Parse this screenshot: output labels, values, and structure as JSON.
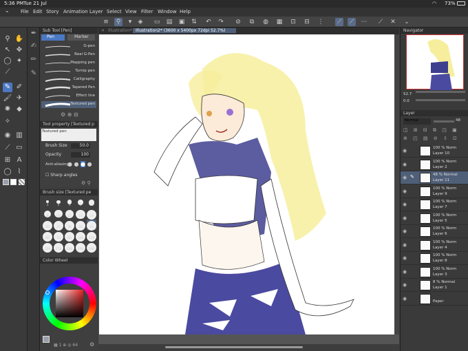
{
  "status": {
    "time": "5:36 PM",
    "date": "Tue 21 Jul",
    "battery": "73%"
  },
  "menu": [
    "File",
    "Edit",
    "Story",
    "Animation",
    "Layer",
    "Select",
    "View",
    "Filter",
    "Window",
    "Help"
  ],
  "subtool": {
    "header": "Sub Tool [Pen]",
    "tabs": [
      "Pen",
      "Marker"
    ],
    "brushes": [
      "G-pen",
      "Real G-Pen",
      "Mapping pen",
      "Turnip pen",
      "Calligraphy",
      "Tapered Pen",
      "Effect line",
      "Textured pen"
    ]
  },
  "toolprop": {
    "header": "Tool property [Textured p",
    "brush_name": "Textured pen",
    "brush_size_label": "Brush Size",
    "brush_size_value": "50.0",
    "opacity_label": "Opacity",
    "opacity_value": "100",
    "antialias_label": "Anti-aliasing",
    "sharp_label": "Sharp angles"
  },
  "brushsize": {
    "header": "Brush size [Textured pe",
    "sizes": [
      "3",
      "4",
      "5",
      "6",
      "7",
      "8",
      "10",
      "12",
      "15",
      "17",
      "20",
      "25",
      "30",
      "40",
      "50",
      "60",
      "70",
      "80",
      "100",
      "120",
      "150",
      "170",
      "200",
      "250",
      "300"
    ]
  },
  "colorwheel": {
    "header": "Color Wheel",
    "footer_value": "64"
  },
  "document": {
    "tab_label": "Illustration*",
    "title": "Illustration2* (3600 x 5400px 72dpi 52.7%)"
  },
  "navigator": {
    "header": "Navigator",
    "zoom": "52.7",
    "angle": "0.0"
  },
  "layer_panel": {
    "header": "Layer",
    "blend": "Normal",
    "opacity": "48",
    "layers": [
      {
        "pct": "100 % Norm",
        "name": "Layer 10"
      },
      {
        "pct": "100 % Norm",
        "name": "Layer 2"
      },
      {
        "pct": "48 % Normal",
        "name": "Layer 11"
      },
      {
        "pct": "100 % Norm",
        "name": "Layer 9"
      },
      {
        "pct": "100 % Norm",
        "name": "Layer 7"
      },
      {
        "pct": "100 % Norm",
        "name": "Layer 5"
      },
      {
        "pct": "100 % Norm",
        "name": "Layer 6"
      },
      {
        "pct": "100 % Norm",
        "name": "Layer 4"
      },
      {
        "pct": "100 % Norm",
        "name": "Layer 8"
      },
      {
        "pct": "100 % Norm",
        "name": "Layer 3"
      },
      {
        "pct": "8 % Normal",
        "name": "Layer 1"
      },
      {
        "pct": "",
        "name": "Paper"
      }
    ]
  }
}
